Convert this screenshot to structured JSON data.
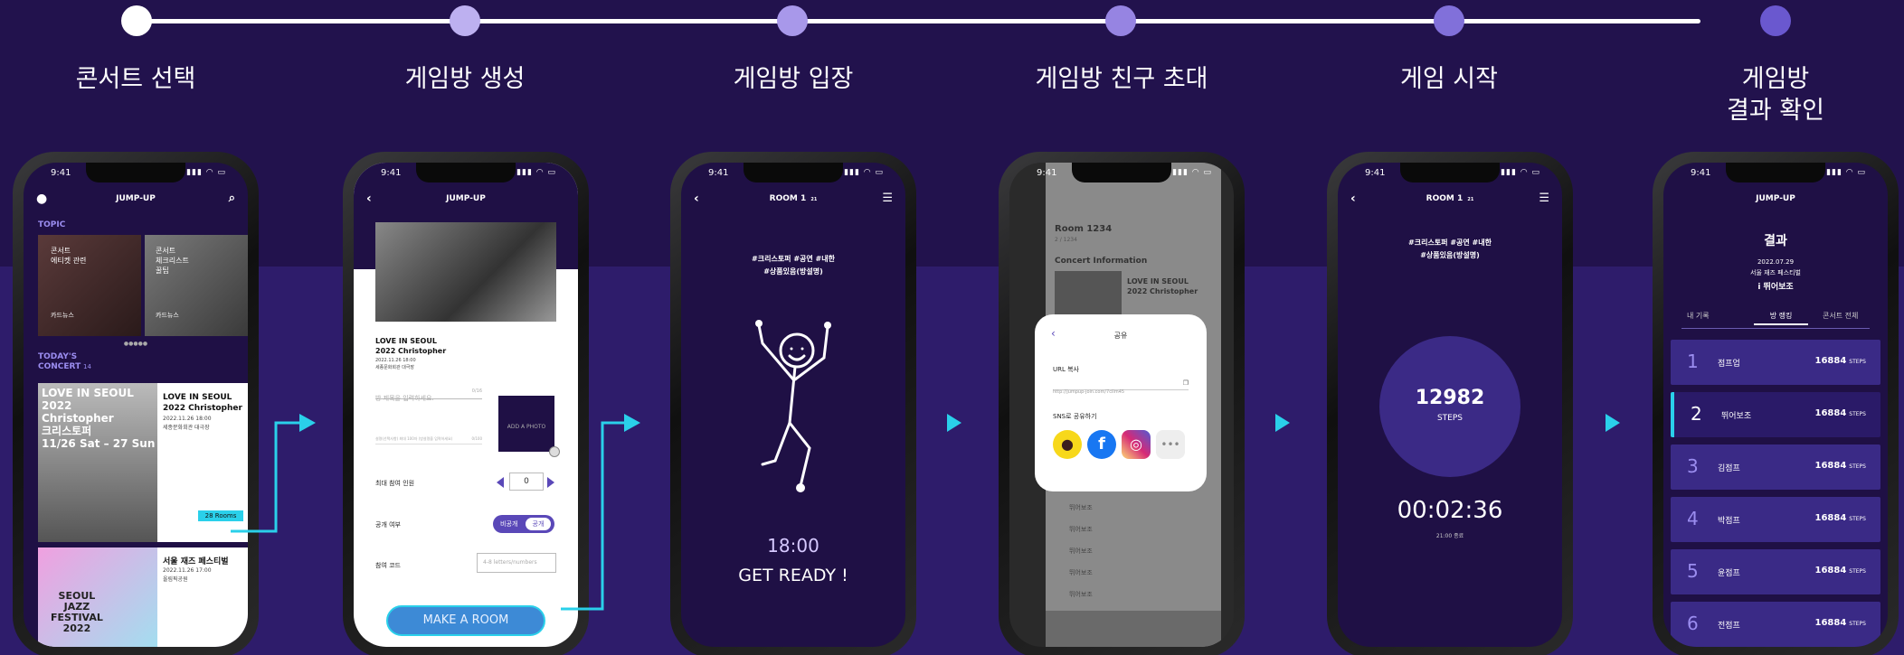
{
  "colors": {
    "accent": "#2ad0ea",
    "purple": "#7c62d6",
    "bg_top": "#22124d",
    "bg_bottom": "#2e1c6b"
  },
  "steps": [
    {
      "label": "콘서트 선택"
    },
    {
      "label": "게임방 생성"
    },
    {
      "label": "게임방 입장"
    },
    {
      "label": "게임방 친구 초대"
    },
    {
      "label": "게임 시작"
    },
    {
      "label": "게임방\n결과 확인"
    }
  ],
  "status_time": "9:41",
  "screen1": {
    "title": "JUMP-UP",
    "topic_label": "TOPIC",
    "cards": [
      {
        "text": "콘서트\n에티켓 관련",
        "tag": "카드뉴스"
      },
      {
        "text": "콘서트\n체크리스트\n꿀팁",
        "tag": "카드뉴스"
      }
    ],
    "today_label": "TODAY'S\nCONCERT",
    "today_count": "14",
    "concerts": [
      {
        "poster": "LOVE IN SEOUL 2022\nChristopher\n크리스토퍼\n11/26 Sat – 27 Sun",
        "name": "LOVE IN SEOUL\n2022 Christopher",
        "date": "2022.11.26 18:00",
        "venue": "세종문화회관 대극장",
        "rooms": "28 Rooms"
      },
      {
        "poster": "SEOUL\nJAZZ\nFESTIVAL\n2022",
        "name": "서울 재즈 페스티벌",
        "date": "2022.11.26 17:00",
        "venue": "올림픽공원"
      }
    ]
  },
  "screen2": {
    "title": "JUMP-UP",
    "concert": "LOVE IN SEOUL\n2022 Christopher",
    "date": "2022.11.26 18:00",
    "venue": "세종문화회관 대극장",
    "title_placeholder": "방 제목을 입력하세요.",
    "title_count": "0/16",
    "add_photo": "ADD A PHOTO",
    "desc_placeholder": "설명(선택사항) 최대 100자 (방설명을 입력하세요)",
    "desc_count": "0/100",
    "max_label": "최대 참여 인원",
    "max_value": "0",
    "public_label": "공개 여부",
    "private_btn": "비공개",
    "public_btn": "공개",
    "code_label": "참여 코드",
    "code_placeholder": "4-8 letters/numbers",
    "make_btn": "MAKE A ROOM"
  },
  "screen3": {
    "room": "ROOM 1",
    "room_sub": "21",
    "tags": "#크리스토퍼 #공연 #내한\n#상품있음(방설명)",
    "time": "18:00",
    "ready": "GET READY !"
  },
  "screen4": {
    "room": "Room 1234",
    "room_sub": "2 / 1234",
    "concert_info": "Concert Information",
    "concert": "LOVE IN SEOUL\n2022 Christopher",
    "popup_title": "공유",
    "url_label": "URL 복사",
    "url": "http://jumpup-join.com/7cIlm45",
    "sns_label": "SNS로 공유하기",
    "members": [
      "뛰어보조",
      "뛰어보조",
      "뛰어보조",
      "뛰어보조",
      "뛰어보조"
    ]
  },
  "screen5": {
    "room": "ROOM 1",
    "room_sub": "21",
    "tags": "#크리스토퍼 #공연 #내한\n#상품있음(방설명)",
    "steps": "12982",
    "steps_label": "STEPS",
    "timer": "00:02:36",
    "end": "21:00 종료"
  },
  "screen6": {
    "title": "JUMP-UP",
    "result": "결과",
    "date": "2022.07.29",
    "place": "서울 재즈 페스티벌",
    "user": "뛰어보조",
    "tabs": [
      "내 기록",
      "방 랭킹",
      "콘서트 전체"
    ],
    "ranks": [
      {
        "n": "1",
        "name": "점프업",
        "steps": "16884"
      },
      {
        "n": "2",
        "name": "뛰어보조",
        "steps": "16884"
      },
      {
        "n": "3",
        "name": "김점프",
        "steps": "16884"
      },
      {
        "n": "4",
        "name": "박점프",
        "steps": "16884"
      },
      {
        "n": "5",
        "name": "윤점프",
        "steps": "16884"
      },
      {
        "n": "6",
        "name": "전점프",
        "steps": "16884"
      }
    ],
    "steps_unit": "STEPS"
  }
}
